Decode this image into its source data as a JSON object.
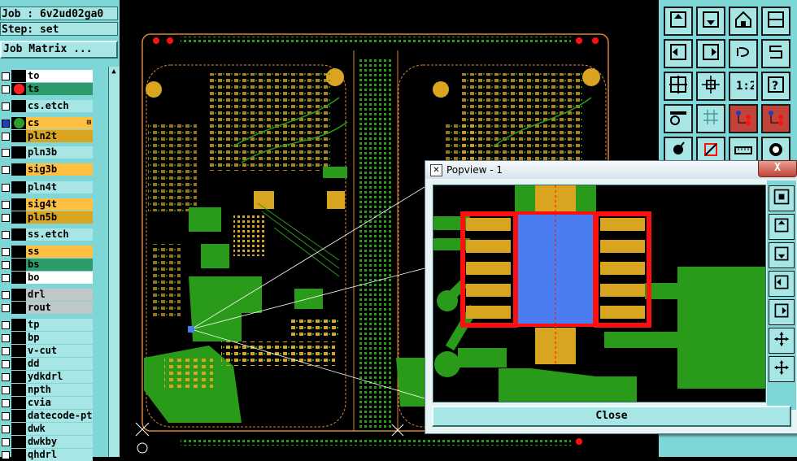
{
  "left_panel": {
    "job_text": "Job : 6v2ud02ga0",
    "step_text": "Step: set",
    "matrix_button": "Job Matrix ...",
    "layers": [
      {
        "name": "to",
        "color": "#ffffff",
        "dot": "",
        "checked": false,
        "marker": ""
      },
      {
        "name": "ts",
        "color": "#2e9b6a",
        "dot": "#ff2020",
        "checked": false,
        "marker": ""
      },
      {
        "name": "cs.etch",
        "color": "#a8e6e6",
        "dot": "",
        "checked": false,
        "marker": ""
      },
      {
        "name": "cs",
        "color": "#ffbf40",
        "dot": "#2aa02a",
        "checked": true,
        "marker": "⊞"
      },
      {
        "name": "pln2t",
        "color": "#d9a520",
        "dot": "",
        "checked": false,
        "marker": ""
      },
      {
        "name": "pln3b",
        "color": "#a8e6e6",
        "dot": "",
        "checked": false,
        "marker": ""
      },
      {
        "name": "sig3b",
        "color": "#ffbf40",
        "dot": "",
        "checked": false,
        "marker": ""
      },
      {
        "name": "pln4t",
        "color": "#a8e6e6",
        "dot": "",
        "checked": false,
        "marker": ""
      },
      {
        "name": "sig4t",
        "color": "#ffbf40",
        "dot": "",
        "checked": false,
        "marker": ""
      },
      {
        "name": "pln5b",
        "color": "#d9a520",
        "dot": "",
        "checked": false,
        "marker": ""
      },
      {
        "name": "ss.etch",
        "color": "#a8e6e6",
        "dot": "",
        "checked": false,
        "marker": ""
      },
      {
        "name": "ss",
        "color": "#ffbf40",
        "dot": "",
        "checked": false,
        "marker": ""
      },
      {
        "name": "bs",
        "color": "#2e9b6a",
        "dot": "",
        "checked": false,
        "marker": ""
      },
      {
        "name": "bo",
        "color": "#ffffff",
        "dot": "",
        "checked": false,
        "marker": ""
      },
      {
        "name": "drl",
        "color": "#bfc7c7",
        "dot": "",
        "checked": false,
        "marker": ""
      },
      {
        "name": "rout",
        "color": "#bfc7c7",
        "dot": "",
        "checked": false,
        "marker": ""
      },
      {
        "name": "tp",
        "color": "#a8e6e6",
        "dot": "",
        "checked": false,
        "marker": ""
      },
      {
        "name": "bp",
        "color": "#a8e6e6",
        "dot": "",
        "checked": false,
        "marker": ""
      },
      {
        "name": "v-cut",
        "color": "#a8e6e6",
        "dot": "",
        "checked": false,
        "marker": ""
      },
      {
        "name": "dd",
        "color": "#a8e6e6",
        "dot": "",
        "checked": false,
        "marker": ""
      },
      {
        "name": "ydkdrl",
        "color": "#a8e6e6",
        "dot": "",
        "checked": false,
        "marker": ""
      },
      {
        "name": "npth",
        "color": "#a8e6e6",
        "dot": "",
        "checked": false,
        "marker": ""
      },
      {
        "name": "cvia",
        "color": "#a8e6e6",
        "dot": "",
        "checked": false,
        "marker": ""
      },
      {
        "name": "datecode-ptc",
        "color": "#a8e6e6",
        "dot": "",
        "checked": false,
        "marker": ""
      },
      {
        "name": "dwk",
        "color": "#a8e6e6",
        "dot": "",
        "checked": false,
        "marker": ""
      },
      {
        "name": "dwkby",
        "color": "#a8e6e6",
        "dot": "",
        "checked": false,
        "marker": ""
      },
      {
        "name": "qhdrl",
        "color": "#a8e6e6",
        "dot": "",
        "checked": false,
        "marker": ""
      }
    ]
  },
  "toolbar": {
    "tools": [
      "zoom-home-up-icon",
      "zoom-home-down-icon",
      "home-icon",
      "window-icon",
      "pan-left-icon",
      "pan-right-icon",
      "undo-view-icon",
      "redraw-icon",
      "zoom-fit-icon",
      "zoom-center-icon",
      "scale-1-2-icon",
      "help-icon",
      "measure-palette-icon",
      "grid-icon",
      "layer-toggle-a-icon",
      "layer-toggle-b-icon",
      "snap-icon",
      "select-icon",
      "ruler-icon",
      "record-icon"
    ]
  },
  "popview": {
    "title": "Popview - 1",
    "close_x": "X",
    "close_button": "Close",
    "side_tools": [
      "fit-icon",
      "pan-up-icon",
      "pan-down-icon",
      "pan-left-icon",
      "pan-right-icon",
      "zoom-in-icon",
      "zoom-out-icon"
    ]
  },
  "colors": {
    "panel": "#7fd6d6",
    "board_bg": "#000000",
    "outline": "#d9853a",
    "copper": "#d9a520",
    "mask": "#2a9a1a",
    "pad_red": "#ff1010",
    "chip": "#4a7ef0"
  }
}
